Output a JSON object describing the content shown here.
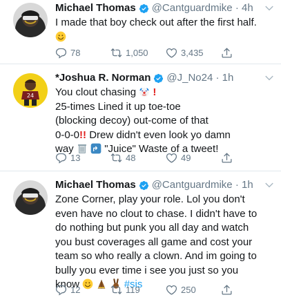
{
  "tweets": [
    {
      "name": "Michael Thomas",
      "handle": "@Cantguardmike",
      "time": "· 4h",
      "lines": [
        "I made that boy check out after the first half."
      ],
      "replies": "78",
      "retweets": "1,050",
      "likes": "3,435"
    },
    {
      "name": "*Joshua R. Norman",
      "handle": "@J_No24",
      "time": "· 1h",
      "line1": "You clout chasing",
      "line2": "25-times Lined it up toe-toe",
      "line3": "(blocking decoy) out-come of that",
      "line4": "0-0-0",
      "line4b": "Drew didn't even look yo damn",
      "line5a": "way",
      "line5b": "\"Juice\" Waste of a tweet!",
      "replies": "13",
      "retweets": "48",
      "likes": "49"
    },
    {
      "name": "Michael Thomas",
      "handle": "@Cantguardmike",
      "time": "· 1h",
      "lines": [
        "Zone Corner, play your role. Lol you don't",
        "even have no clout to chase. I didn't have to",
        "do nothing but punk you all day and watch",
        "you bust coverages all game and cost your",
        "team so who really a clown. And im going to",
        "bully you ever time i see you just so you"
      ],
      "last": "know",
      "hashtag": "#sis",
      "replies": "12",
      "retweets": "119",
      "likes": "250"
    }
  ],
  "icons": {
    "verified": "verified-badge-icon",
    "reply": "reply-icon",
    "retweet": "retweet-icon",
    "like": "heart-icon",
    "share": "share-icon",
    "menu": "chevron-down-icon"
  },
  "colors": {
    "link": "#1da1f2",
    "muted": "#657786",
    "retweet_bg": "#e1e8ed"
  }
}
